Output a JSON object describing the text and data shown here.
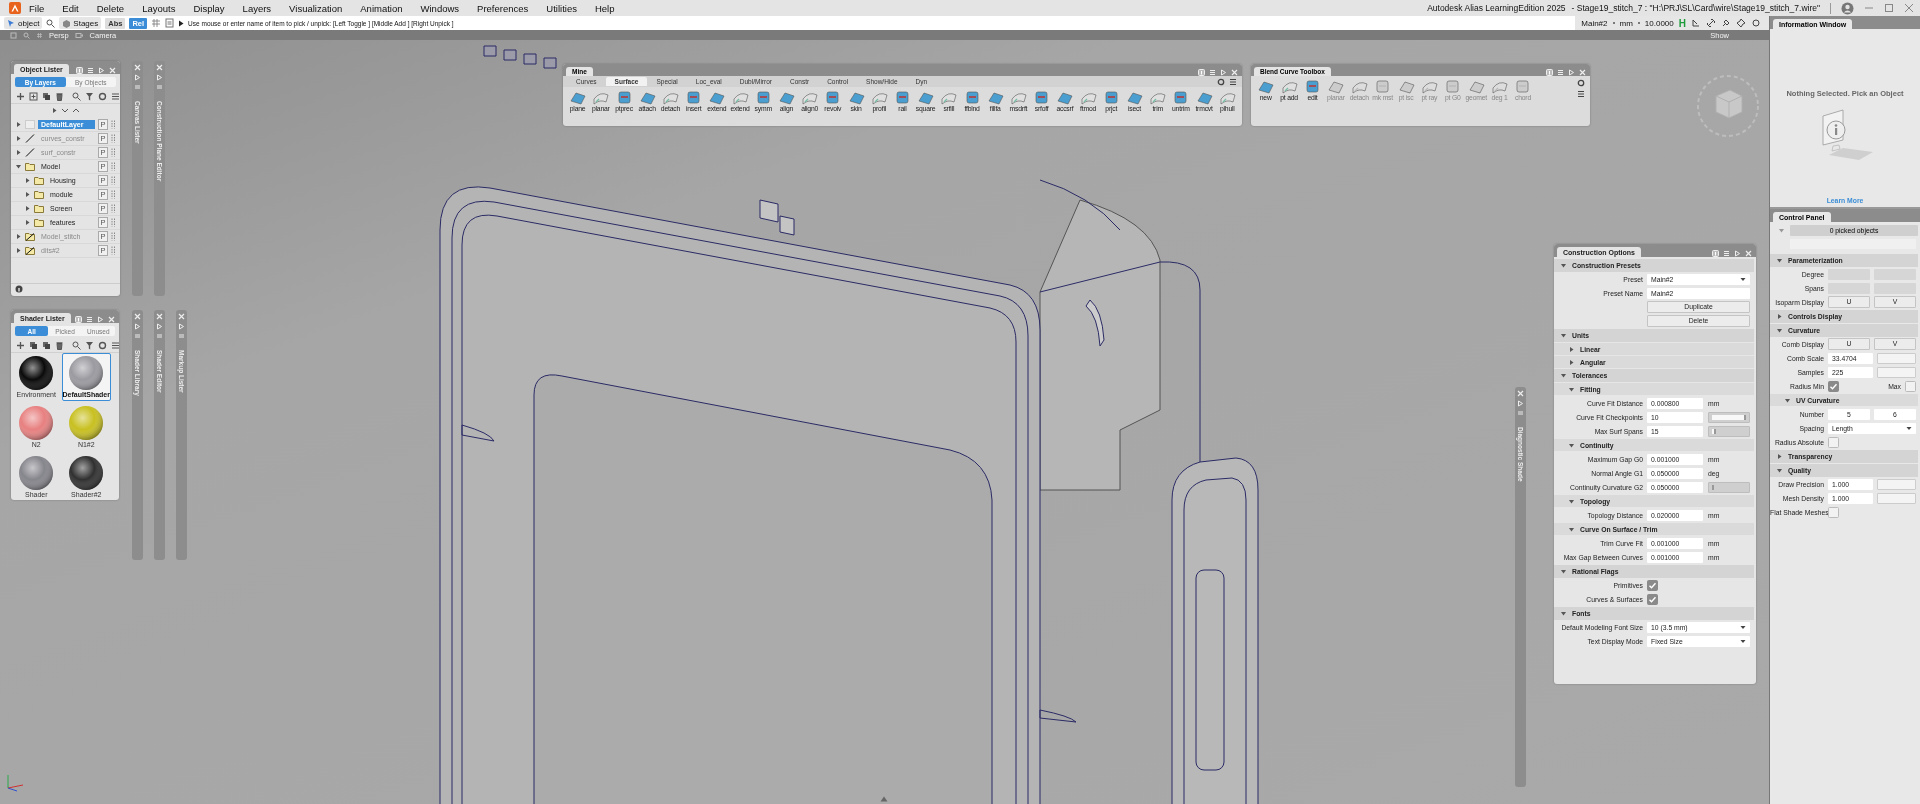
{
  "menu_bar": {
    "items": [
      "File",
      "Edit",
      "Delete",
      "Layouts",
      "Display",
      "Layers",
      "Visualization",
      "Animation",
      "Windows",
      "Preferences",
      "Utilities",
      "Help"
    ],
    "app_title": "Autodesk Alias LearningEdition 2025",
    "document_title": "- Stage19_stitch_7 : \"H:\\PRJ\\SL\\Card\\wire\\Stage19_stitch_7.wire\""
  },
  "toolbar": {
    "pick": "object",
    "stages": "Stages",
    "modes": [
      {
        "label": "Abs",
        "selected": false
      },
      {
        "label": "Rel",
        "selected": true
      }
    ],
    "prompt": "Use mouse or enter name of item to pick / unpick: [Left Toggle ] [Middle Add ] [Right Unpick ]",
    "preset": "Main#2",
    "unit": "mm",
    "tolerance": "10.0000",
    "history": "H"
  },
  "viewport": {
    "view": "Persp",
    "camera": "Camera",
    "show": "Show"
  },
  "object_lister": {
    "title": "Object Lister",
    "tabs": [
      {
        "label": "By Layers",
        "selected": true
      },
      {
        "label": "By Objects",
        "selected": false
      }
    ],
    "layers": [
      {
        "name": "DefaultLayer",
        "kind": "layer",
        "hidden": false,
        "selected": true,
        "expanded": false,
        "badge": "P"
      },
      {
        "name": "curves_constr",
        "kind": "layer",
        "hidden": true,
        "selected": false,
        "expanded": false,
        "badge": "P"
      },
      {
        "name": "surf_constr",
        "kind": "layer",
        "hidden": true,
        "selected": false,
        "expanded": false,
        "badge": "P"
      },
      {
        "name": "Model",
        "kind": "folder",
        "hidden": false,
        "selected": false,
        "expanded": true,
        "badge": "P",
        "children": [
          {
            "name": "Housing",
            "kind": "folder",
            "hidden": false,
            "selected": false,
            "expanded": false,
            "badge": "P"
          },
          {
            "name": "module",
            "kind": "folder",
            "hidden": false,
            "selected": false,
            "expanded": false,
            "badge": "P"
          },
          {
            "name": "Screen",
            "kind": "folder",
            "hidden": false,
            "selected": false,
            "expanded": false,
            "badge": "P"
          },
          {
            "name": "features",
            "kind": "folder",
            "hidden": false,
            "selected": false,
            "expanded": false,
            "badge": "P"
          }
        ]
      },
      {
        "name": "Model_stitch",
        "kind": "folder",
        "hidden": true,
        "selected": false,
        "expanded": false,
        "badge": "P"
      },
      {
        "name": "dits#2",
        "kind": "folder",
        "hidden": true,
        "selected": false,
        "expanded": false,
        "badge": "P"
      }
    ]
  },
  "shader_lister": {
    "title": "Shader Lister",
    "tabs": [
      {
        "label": "All",
        "selected": true
      },
      {
        "label": "Picked",
        "selected": false
      },
      {
        "label": "Unused",
        "selected": false
      }
    ],
    "shaders": [
      {
        "name": "Environment",
        "color": "#0a0a0a",
        "selected": false
      },
      {
        "name": "DefaultShader",
        "color": "#9a9aa0",
        "selected": true
      },
      {
        "name": "N2",
        "color": "#e88080",
        "selected": false
      },
      {
        "name": "N1#2",
        "color": "#c8c020",
        "selected": false
      },
      {
        "name": "Shader",
        "color": "#85858c",
        "selected": false
      },
      {
        "name": "Shader#2",
        "color": "#303030",
        "selected": false
      }
    ]
  },
  "side_strips": [
    {
      "label": "Canvas Lister"
    },
    {
      "label": "Construction Plane Editor"
    },
    {
      "label": "Shader Library"
    },
    {
      "label": "Shader Editor"
    },
    {
      "label": "Markup Lister"
    },
    {
      "label": "Diagnostic Shade"
    }
  ],
  "mine_shelf": {
    "title": "Mine",
    "tabs": [
      {
        "label": "Curves",
        "selected": false
      },
      {
        "label": "Surface",
        "selected": true
      },
      {
        "label": "Special",
        "selected": false
      },
      {
        "label": "Loc_eval",
        "selected": false
      },
      {
        "label": "Dubl/Mirror",
        "selected": false
      },
      {
        "label": "Constr",
        "selected": false
      },
      {
        "label": "Control",
        "selected": false
      },
      {
        "label": "Show/Hide",
        "selected": false
      },
      {
        "label": "Dyn",
        "selected": false
      }
    ],
    "tools": [
      "plane",
      "planar",
      "ptprec",
      "attach",
      "detach",
      "insert",
      "extend",
      "extend",
      "symm",
      "align",
      "align0",
      "revolv",
      "skin",
      "profil",
      "rail",
      "square",
      "srfill",
      "ffblnd",
      "fillfa",
      "msdrft",
      "srfoff",
      "accsrf",
      "ftmod",
      "prjct",
      "isect",
      "trim",
      "untrim",
      "trmcvt",
      "plhull"
    ]
  },
  "blend_toolbox": {
    "title": "Blend Curve Toolbox",
    "tools": [
      {
        "label": "new",
        "disabled": false
      },
      {
        "label": "pt add",
        "disabled": false
      },
      {
        "label": "edit",
        "disabled": false
      },
      {
        "label": "planar",
        "disabled": true
      },
      {
        "label": "detach",
        "disabled": true
      },
      {
        "label": "mk mst",
        "disabled": true
      },
      {
        "label": "pt isc",
        "disabled": true
      },
      {
        "label": "pt ray",
        "disabled": true
      },
      {
        "label": "pt G0",
        "disabled": true
      },
      {
        "label": "geomet",
        "disabled": true
      },
      {
        "label": "deg 1",
        "disabled": true
      },
      {
        "label": "chord",
        "disabled": true
      }
    ]
  },
  "construction_options": {
    "title": "Construction Options",
    "sections": [
      {
        "title": "Construction Presets",
        "expanded": true,
        "rows": [
          {
            "kind": "dropdown",
            "label": "Preset",
            "value": "Main#2"
          },
          {
            "kind": "text",
            "label": "Preset Name",
            "value": "Main#2"
          },
          {
            "kind": "button",
            "label": "Duplicate"
          },
          {
            "kind": "button",
            "label": "Delete"
          }
        ]
      },
      {
        "title": "Units",
        "expanded": true,
        "subsections": [
          {
            "title": "Linear",
            "expanded": false
          },
          {
            "title": "Angular",
            "expanded": false
          }
        ]
      },
      {
        "title": "Tolerances",
        "expanded": true,
        "subsections": [
          {
            "title": "Fitting",
            "expanded": true,
            "rows": [
              {
                "kind": "field",
                "label": "Curve Fit Distance",
                "value": "0.000800",
                "unit": "mm"
              },
              {
                "kind": "slider_field",
                "label": "Curve Fit Checkpoints",
                "value": "10",
                "level": 1.0
              },
              {
                "kind": "slider_field",
                "label": "Max Surf Spans",
                "value": "15",
                "level": 0.12
              }
            ]
          },
          {
            "title": "Continuity",
            "expanded": true,
            "rows": [
              {
                "kind": "field",
                "label": "Maximum Gap G0",
                "value": "0.001000",
                "unit": "mm"
              },
              {
                "kind": "field",
                "label": "Normal Angle G1",
                "value": "0.050000",
                "unit": "deg"
              },
              {
                "kind": "slider_field",
                "label": "Continuity Curvature G2",
                "value": "0.050000",
                "level": 0.03
              }
            ]
          },
          {
            "title": "Topology",
            "expanded": true,
            "rows": [
              {
                "kind": "field",
                "label": "Topology Distance",
                "value": "0.020000",
                "unit": "mm"
              }
            ]
          },
          {
            "title": "Curve On Surface / Trim",
            "expanded": true,
            "rows": [
              {
                "kind": "field",
                "label": "Trim Curve Fit",
                "value": "0.001000",
                "unit": "mm"
              },
              {
                "kind": "field",
                "label": "Max Gap Between Curves",
                "value": "0.001000",
                "unit": "mm"
              }
            ]
          }
        ]
      },
      {
        "title": "Rational Flags",
        "expanded": true,
        "rows": [
          {
            "kind": "checkbox",
            "label": "Primitives",
            "checked": true
          },
          {
            "kind": "checkbox",
            "label": "Curves & Surfaces",
            "checked": true
          }
        ]
      },
      {
        "title": "Fonts",
        "expanded": true,
        "rows": [
          {
            "kind": "dropdown",
            "label": "Default Modeling Font Size",
            "value": "10 (3.5 mm)"
          },
          {
            "kind": "dropdown",
            "label": "Text Display Mode",
            "value": "Fixed Size"
          }
        ]
      }
    ]
  },
  "information_window": {
    "title": "Information Window",
    "message": "Nothing Selected. Pick an Object",
    "link": "Learn More"
  },
  "control_panel": {
    "title": "Control Panel",
    "picked": "0 picked objects",
    "sections": [
      {
        "title": "Parameterization",
        "expanded": true,
        "rows": [
          {
            "kind": "empty_pair",
            "label": "Degree"
          },
          {
            "kind": "empty_pair",
            "label": "Spans"
          },
          {
            "kind": "toggle_pair",
            "label": "Isoparm Display",
            "options": [
              "U",
              "V"
            ]
          }
        ]
      },
      {
        "title": "Controls Display",
        "expanded": false
      },
      {
        "title": "Curvature",
        "expanded": true,
        "rows": [
          {
            "kind": "toggle_pair",
            "label": "Comb Display",
            "options": [
              "U",
              "V"
            ]
          },
          {
            "kind": "spare_field",
            "label": "Comb Scale",
            "value": "33.4704"
          },
          {
            "kind": "spare_field",
            "label": "Samples",
            "value": "225"
          },
          {
            "kind": "checkbox_pair",
            "label": "Radius Min",
            "checked": true,
            "label2": "Max",
            "checked2": false
          }
        ],
        "subsections": [
          {
            "title": "UV Curvature",
            "expanded": true,
            "rows": [
              {
                "kind": "value_pair",
                "label": "Number",
                "values": [
                  "5",
                  "6"
                ]
              },
              {
                "kind": "dropdown",
                "label": "Spacing",
                "value": "Length"
              },
              {
                "kind": "checkbox",
                "label": "Radius Absolute",
                "checked": false
              }
            ]
          }
        ]
      },
      {
        "title": "Transparency",
        "expanded": false
      },
      {
        "title": "Quality",
        "expanded": true,
        "rows": [
          {
            "kind": "spare_field",
            "label": "Draw Precision",
            "value": "1.000"
          },
          {
            "kind": "spare_field",
            "label": "Mesh Density",
            "value": "1.000"
          },
          {
            "kind": "checkbox",
            "label": "Flat Shade Meshes",
            "checked": false
          }
        ]
      }
    ]
  }
}
